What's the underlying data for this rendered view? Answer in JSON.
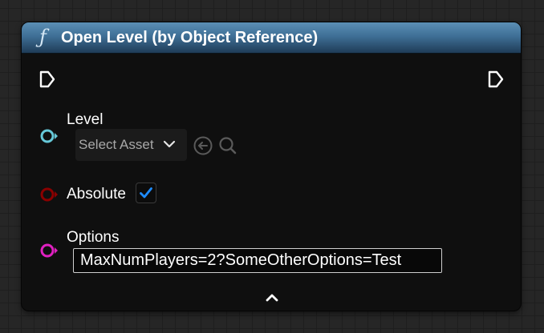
{
  "node": {
    "title": "Open Level (by Object Reference)",
    "function_icon": "function-icon",
    "pins": {
      "level": {
        "label": "Level",
        "select_value": "Select Asset",
        "icons": [
          "chevron-down-icon",
          "back-arrow-icon",
          "search-icon"
        ]
      },
      "absolute": {
        "label": "Absolute",
        "checked": true
      },
      "options": {
        "label": "Options",
        "value": "MaxNumPlayers=2?SomeOtherOptions=Test"
      }
    },
    "colors": {
      "header": "#3f6f96",
      "object_pin": "#66c8d8",
      "bool_pin": "#8b0000",
      "string_pin": "#e020c0",
      "checkmark": "#1e8cff"
    }
  }
}
